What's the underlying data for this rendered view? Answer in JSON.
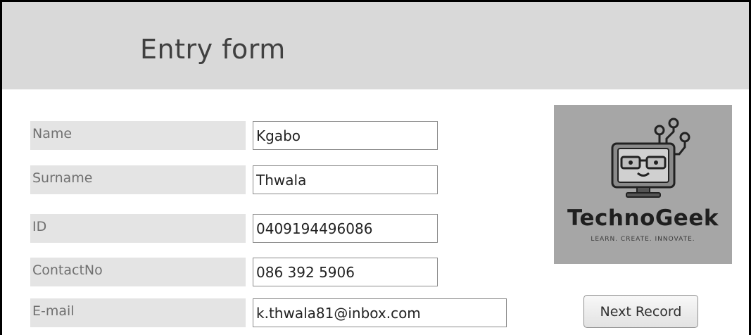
{
  "form": {
    "title": "Entry form"
  },
  "fields": [
    {
      "label": "Name",
      "value": "Kgabo"
    },
    {
      "label": "Surname",
      "value": "Thwala"
    },
    {
      "label": "ID",
      "value": "0409194496086"
    },
    {
      "label": "ContactNo",
      "value": "086 392 5906"
    },
    {
      "label": "E-mail",
      "value": "k.thwala81@inbox.com"
    }
  ],
  "logo": {
    "brand": "TechnoGeek",
    "tagline": "LEARN.  CREATE.  INNOVATE.",
    "icon": "robot-computer-icon"
  },
  "buttons": {
    "next_record": "Next Record"
  }
}
